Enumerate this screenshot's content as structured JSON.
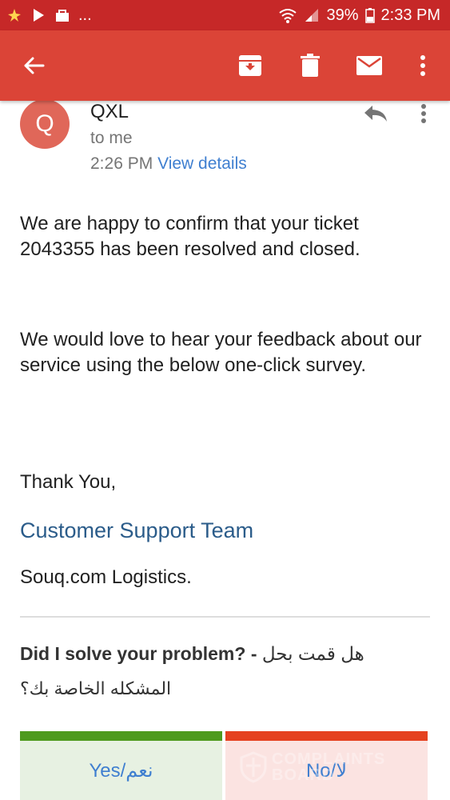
{
  "status_bar": {
    "notification_icons": [
      "app-notification-icon",
      "play-store-icon",
      "shopping-icon"
    ],
    "more_notifications": "...",
    "battery": "39%",
    "time": "2:33 PM"
  },
  "app_bar": {
    "icons": [
      "back-arrow-icon",
      "archive-icon",
      "trash-icon",
      "mail-icon",
      "more-vert-icon"
    ]
  },
  "email": {
    "avatar_letter": "Q",
    "sender": "QXL",
    "recipient": "to me",
    "time": "2:26 PM",
    "view_details": "View details",
    "paragraph1": "We are happy to confirm that your ticket 2043355 has been resolved and closed.",
    "paragraph2": "We would love to hear your feedback about our service using the below one-click survey.",
    "thanks": "Thank You,",
    "team": "Customer Support Team",
    "company": "Souq.com Logistics.",
    "survey_question": "Did I solve your problem? -",
    "survey_question_ar": "هل قمت بحل",
    "survey_question_ar2": "المشكله الخاصة بك؟",
    "yes_label": "Yes/نعم",
    "no_label": "No/لا"
  },
  "watermark": {
    "line1": "COMPLAINTS",
    "line2": "BOARD"
  },
  "colors": {
    "status_bar": "#c62828",
    "app_bar": "#db4437",
    "avatar": "#e06759",
    "link": "#3f7fd0",
    "team": "#2b5c8a",
    "yes_bar": "#4e9a1e",
    "no_bar": "#e5411f"
  }
}
